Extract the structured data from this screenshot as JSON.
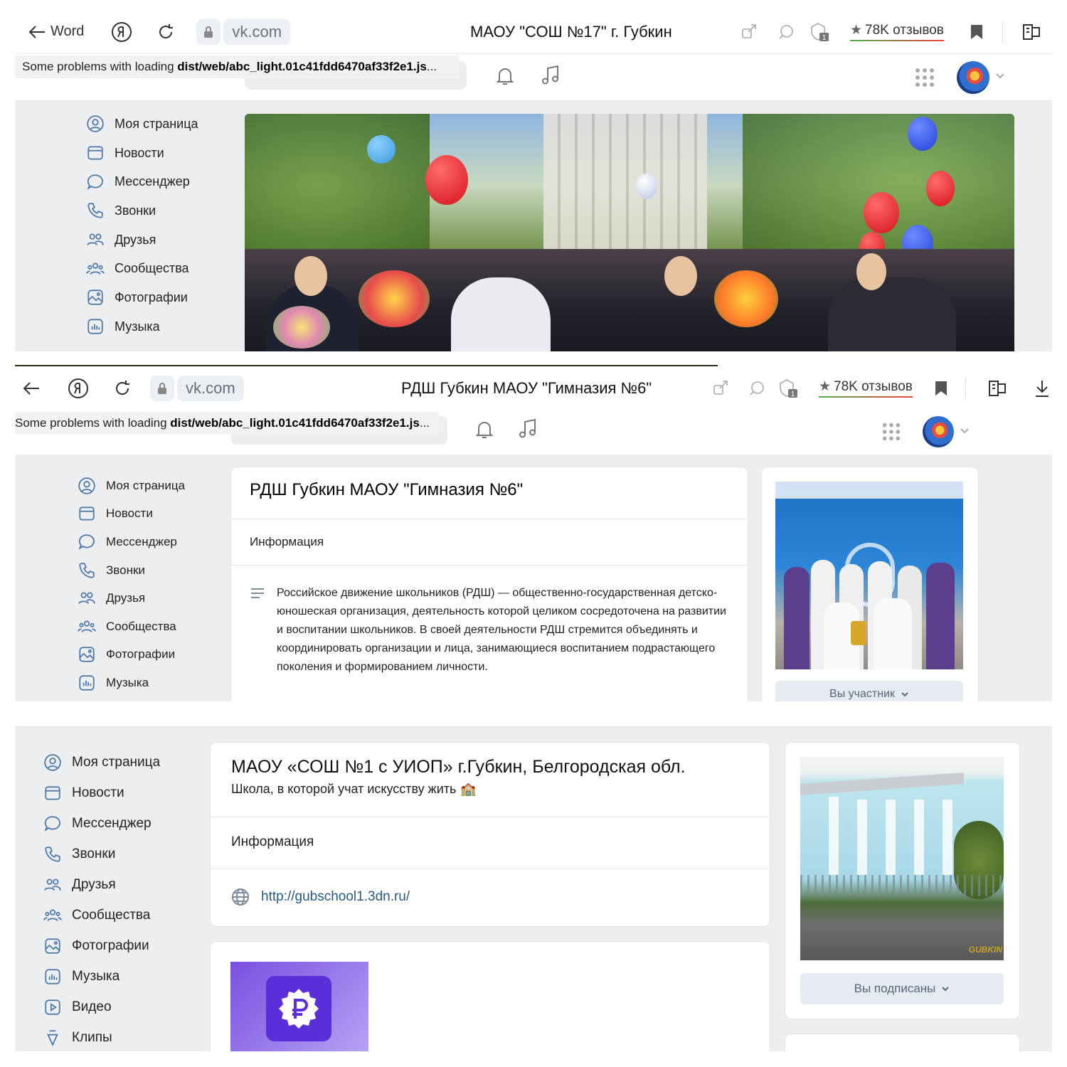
{
  "panel1": {
    "back_label": "Word",
    "url": "vk.com",
    "page_title": "МАОУ \"СОШ №17\" г. Губкин",
    "reviews": "78K отзывов",
    "warning_prefix": "Some problems with loading ",
    "warning_file": "dist/web/abc_light.01c41fdd6470af33f2e1.js",
    "warning_suffix": "...",
    "nav": [
      "Моя страница",
      "Новости",
      "Мессенджер",
      "Звонки",
      "Друзья",
      "Сообщества",
      "Фотографии",
      "Музыка"
    ]
  },
  "panel2": {
    "url": "vk.com",
    "page_title": "РДШ Губкин МАОУ \"Гимназия №6\"",
    "reviews": "78K отзывов",
    "warning_prefix": "Some problems with loading ",
    "warning_file": "dist/web/abc_light.01c41fdd6470af33f2e1.js",
    "warning_suffix": "...",
    "nav": [
      "Моя страница",
      "Новости",
      "Мессенджер",
      "Звонки",
      "Друзья",
      "Сообщества",
      "Фотографии",
      "Музыка"
    ],
    "group_title": "РДШ Губкин МАОУ \"Гимназия №6\"",
    "info_header": "Информация",
    "description": "Российское движение школьников (РДШ) — общественно-государственная детско-юношеская организация, деятельность которой целиком сосредоточена на развитии и воспитании школьников. В своей деятельности РДШ стремится объединять и координировать организации и лица, занимающиеся воспитанием подрастающего поколения и формированием личности.",
    "member_button": "Вы участник"
  },
  "panel3": {
    "nav": [
      "Моя страница",
      "Новости",
      "Мессенджер",
      "Звонки",
      "Друзья",
      "Сообщества",
      "Фотографии",
      "Музыка",
      "Видео",
      "Клипы"
    ],
    "group_title": "МАОУ «СОШ №1 с УИОП» г.Губкин, Белгородская обл.",
    "group_status": "Школа, в которой учат искусству жить",
    "status_emoji": "🏫",
    "info_header": "Информация",
    "website": "http://gubschool1.3dn.ru/",
    "subscribe_button": "Вы подписаны",
    "photo_watermark": "GUBKIN"
  },
  "colors": {
    "vk_blue": "#4a76a8",
    "link": "#2a5885",
    "bg": "#edeef0"
  }
}
